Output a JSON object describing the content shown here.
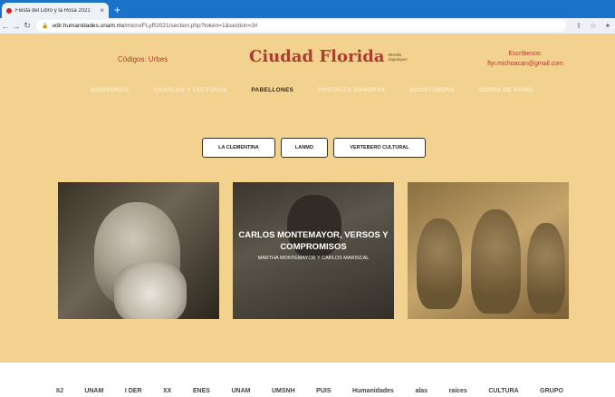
{
  "browser": {
    "tab_title": "Fiesta del Libro y la Rosa 2021",
    "url_host": "udir.humanidades.unam.mx",
    "url_path": "/micro/FLyR2021/section.php?token=1&section=3#"
  },
  "header": {
    "codigos": "Códigos: Urbes",
    "logo_title": "Ciudad Florida",
    "logo_subtitle": "Morelia Zapotepec",
    "contact_label": "Escríbenos:",
    "contact_email": "flyr.michoacan@gmail.com"
  },
  "nav": {
    "items": [
      {
        "label": "BIENVENIDA",
        "active": false
      },
      {
        "label": "CHARLAS Y LECTURAS",
        "active": false
      },
      {
        "label": "PABELLONES",
        "active": true
      },
      {
        "label": "POSTALES SONORAS",
        "active": false
      },
      {
        "label": "BOOKTUBERS",
        "active": false
      },
      {
        "label": "ZORRO DE PAPEL",
        "active": false
      }
    ]
  },
  "subnav": {
    "buttons": [
      "LA CLEMENTINA",
      "LANMO",
      "VERTEBERO CULTURAL"
    ]
  },
  "featured": {
    "title": "CARLOS MONTEMAYOR, VERSOS Y COMPROMISOS",
    "subtitle": "MARTHA MONTEMAYOR Y CARLOS MARISCAL"
  },
  "footer": {
    "sponsors": [
      "IIJ",
      "UNAM",
      "I DER",
      "XX",
      "ENES",
      "UNAM",
      "UMSNH",
      "PUIS",
      "Humanidades",
      "alas",
      "raíces",
      "CULTURA",
      "GRUPO"
    ]
  }
}
